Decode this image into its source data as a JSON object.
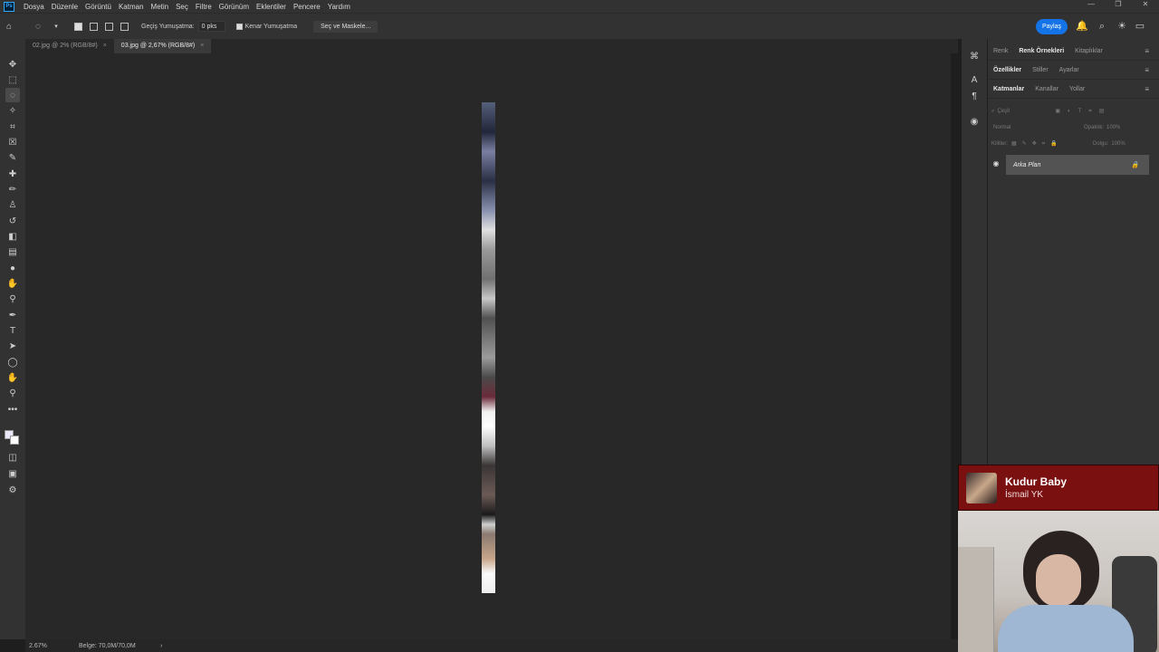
{
  "menubar": {
    "logo": "Ps",
    "items": [
      "Dosya",
      "Düzenle",
      "Görüntü",
      "Katman",
      "Metin",
      "Seç",
      "Filtre",
      "Görünüm",
      "Eklentiler",
      "Pencere",
      "Yardım"
    ],
    "window_buttons": [
      "—",
      "❐",
      "✕"
    ]
  },
  "options": {
    "feather_label": "Geçiş Yumuşatma:",
    "feather_value": "0 pks",
    "antialias_label": "Kenar Yumuşatma",
    "select_mask_label": "Seç ve Maskele..."
  },
  "topbar": {
    "share_label": "Paylaş"
  },
  "tabs": [
    {
      "label": "02.jpg @ 2% (RGB/8#)",
      "close": "×"
    },
    {
      "label": "03.jpg @ 2,67% (RGB/8#)",
      "close": "×"
    }
  ],
  "status": {
    "zoom": "2.67%",
    "doc": "Belge: 70,0M/70,0M",
    "arrow": "›"
  },
  "panels": {
    "group1_tabs": [
      "Renk",
      "Renk Örnekleri",
      "Kitaplıklar"
    ],
    "group2_tabs": [
      "Özellikler",
      "Stiller",
      "Ayarlar"
    ],
    "group3_tabs": [
      "Katmanlar",
      "Kanallar",
      "Yollar"
    ],
    "filter_placeholder": "Çeşit",
    "blend_mode": "Normal",
    "opacity_label": "Opaklık:",
    "opacity_value": "100%",
    "lock_label": "Kilitler:",
    "fill_label": "Dolgu:",
    "fill_value": "100%",
    "layer_name": "Arka Plan"
  },
  "music": {
    "song": "Kudur Baby",
    "artist": "İsmail YK"
  }
}
